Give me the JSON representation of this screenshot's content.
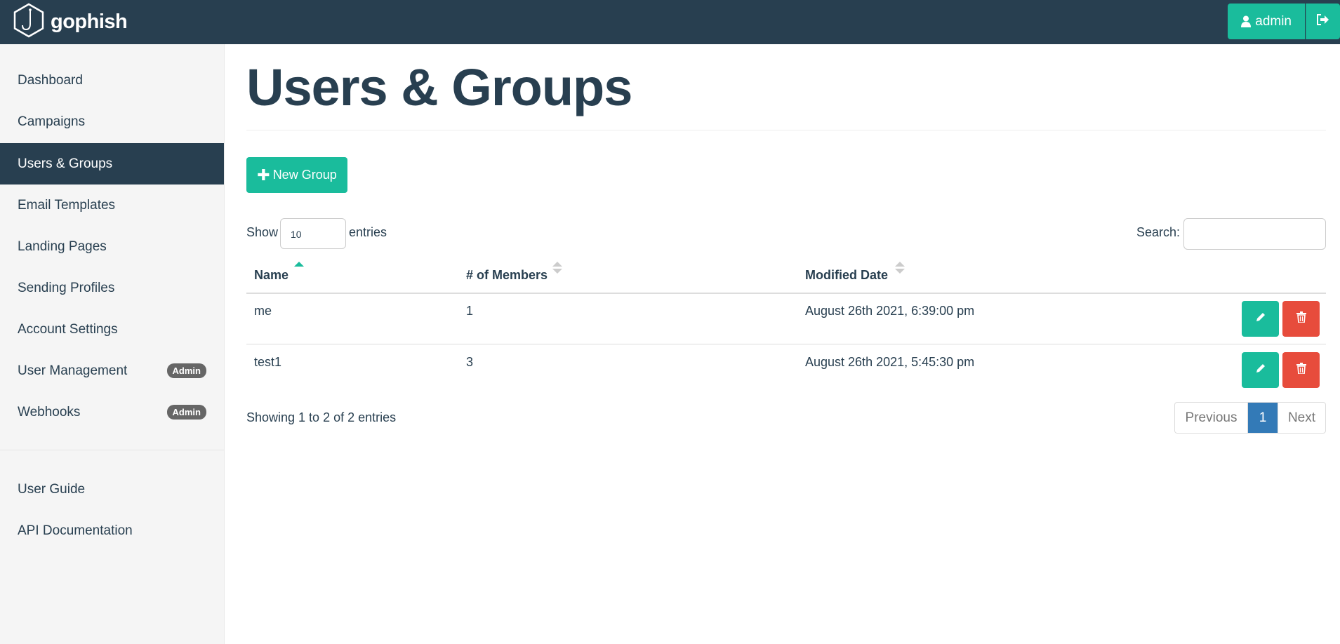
{
  "navbar": {
    "brand": "gophish",
    "user_label": "admin"
  },
  "sidebar": {
    "items": [
      {
        "label": "Dashboard"
      },
      {
        "label": "Campaigns"
      },
      {
        "label": "Users & Groups",
        "active": true
      },
      {
        "label": "Email Templates"
      },
      {
        "label": "Landing Pages"
      },
      {
        "label": "Sending Profiles"
      },
      {
        "label": "Account Settings"
      },
      {
        "label": "User Management",
        "badge": "Admin"
      },
      {
        "label": "Webhooks",
        "badge": "Admin"
      }
    ],
    "bottom_items": [
      {
        "label": "User Guide"
      },
      {
        "label": "API Documentation"
      }
    ]
  },
  "main": {
    "title": "Users & Groups",
    "new_group_label": "New Group",
    "show_label": "Show",
    "entries_value": "10",
    "entries_label": "entries",
    "search_label": "Search:",
    "search_value": "",
    "table": {
      "headers": [
        "Name",
        "# of Members",
        "Modified Date"
      ],
      "rows": [
        {
          "name": "me",
          "members": "1",
          "modified": "August 26th 2021, 6:39:00 pm"
        },
        {
          "name": "test1",
          "members": "3",
          "modified": "August 26th 2021, 5:45:30 pm"
        }
      ]
    },
    "showing_text": "Showing 1 to 2 of 2 entries",
    "pagination": {
      "previous": "Previous",
      "current": "1",
      "next": "Next"
    }
  },
  "colors": {
    "navbar": "#283f50",
    "accent": "#1abc9c",
    "danger": "#e74c3c",
    "pager_active": "#337ab7"
  }
}
